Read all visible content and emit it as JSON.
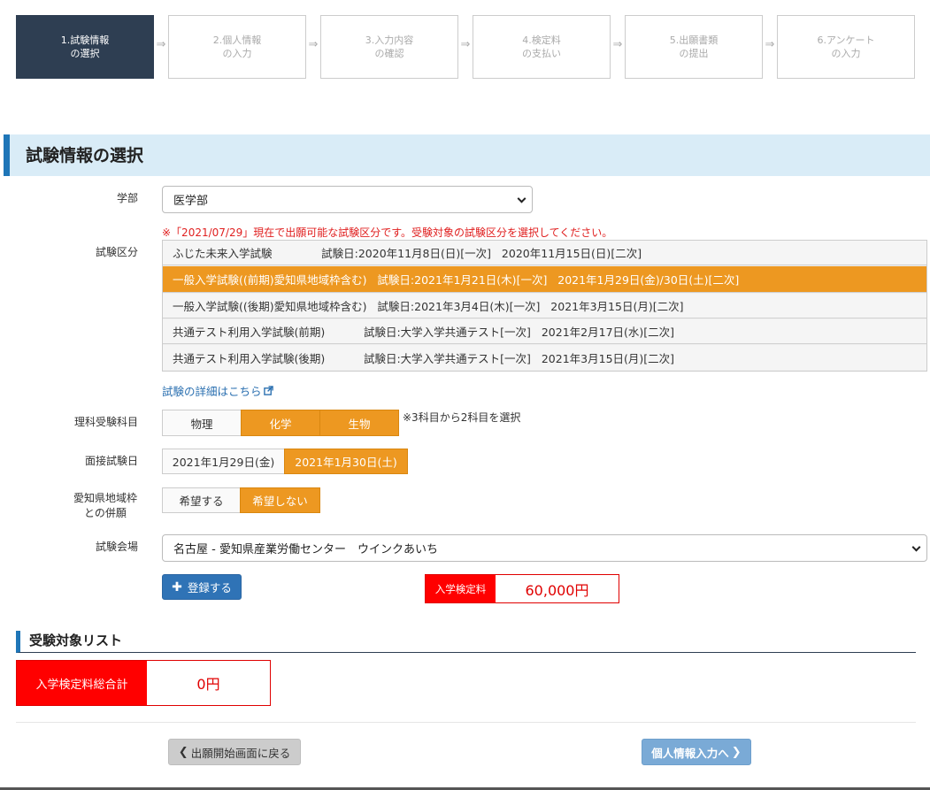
{
  "steps": [
    {
      "label": "1.試験情報\nの選択",
      "active": true
    },
    {
      "label": "2.個人情報\nの入力",
      "active": false
    },
    {
      "label": "3.入力内容\nの確認",
      "active": false
    },
    {
      "label": "4.検定料\nの支払い",
      "active": false
    },
    {
      "label": "5.出願書類\nの提出",
      "active": false
    },
    {
      "label": "6.アンケート\nの入力",
      "active": false
    }
  ],
  "step_arrow": "⇒",
  "section_title": "試験情報の選択",
  "faculty": {
    "label": "学部",
    "value": "医学部"
  },
  "notice": "※「2021/07/29」現在で出願可能な試験区分です。受験対象の試験区分を選択してください。",
  "exam_category": {
    "label": "試験区分",
    "rows": [
      {
        "text": "ふじた未来入学試験              試験日:2020年11月8日(日)[一次]   2020年11月15日(日)[二次]",
        "selected": false
      },
      {
        "text": "一般入学試験((前期)愛知県地域枠含む)   試験日:2021年1月21日(木)[一次]   2021年1月29日(金)/30日(土)[二次]",
        "selected": true
      },
      {
        "text": "一般入学試験((後期)愛知県地域枠含む)   試験日:2021年3月4日(木)[一次]   2021年3月15日(月)[二次]",
        "selected": false
      },
      {
        "text": "共通テスト利用入学試験(前期)           試験日:大学入学共通テスト[一次]   2021年2月17日(水)[二次]",
        "selected": false
      },
      {
        "text": "共通テスト利用入学試験(後期)           試験日:大学入学共通テスト[一次]   2021年3月15日(月)[二次]",
        "selected": false
      }
    ]
  },
  "detail_link": "試験の詳細はこちら",
  "science": {
    "label": "理科受験科目",
    "options": [
      {
        "text": "物理",
        "selected": false
      },
      {
        "text": "化学",
        "selected": true
      },
      {
        "text": "生物",
        "selected": true
      }
    ],
    "note": "※3科目から2科目を選択"
  },
  "interview": {
    "label": "面接試験日",
    "options": [
      {
        "text": "2021年1月29日(金)",
        "selected": false
      },
      {
        "text": "2021年1月30日(土)",
        "selected": true
      }
    ]
  },
  "aichi": {
    "label": "愛知県地域枠\nとの併願",
    "options": [
      {
        "text": "希望する",
        "selected": false
      },
      {
        "text": "希望しない",
        "selected": true
      }
    ]
  },
  "venue": {
    "label": "試験会場",
    "value": "名古屋 - 愛知県産業労働センター　ウインクあいち"
  },
  "register_button": "登録する",
  "fee": {
    "label": "入学検定料",
    "value": "60,000円"
  },
  "target_list": {
    "title": "受験対象リスト"
  },
  "total": {
    "label": "入学検定料総合計",
    "value": "0円"
  },
  "back_button": "出願開始画面に戻る",
  "next_button": "個人情報入力へ",
  "colors": {
    "accent_orange": "#ed9821",
    "header_navy": "#2e3e52",
    "link_blue": "#1f76b8",
    "fee_red": "#ff0000"
  }
}
